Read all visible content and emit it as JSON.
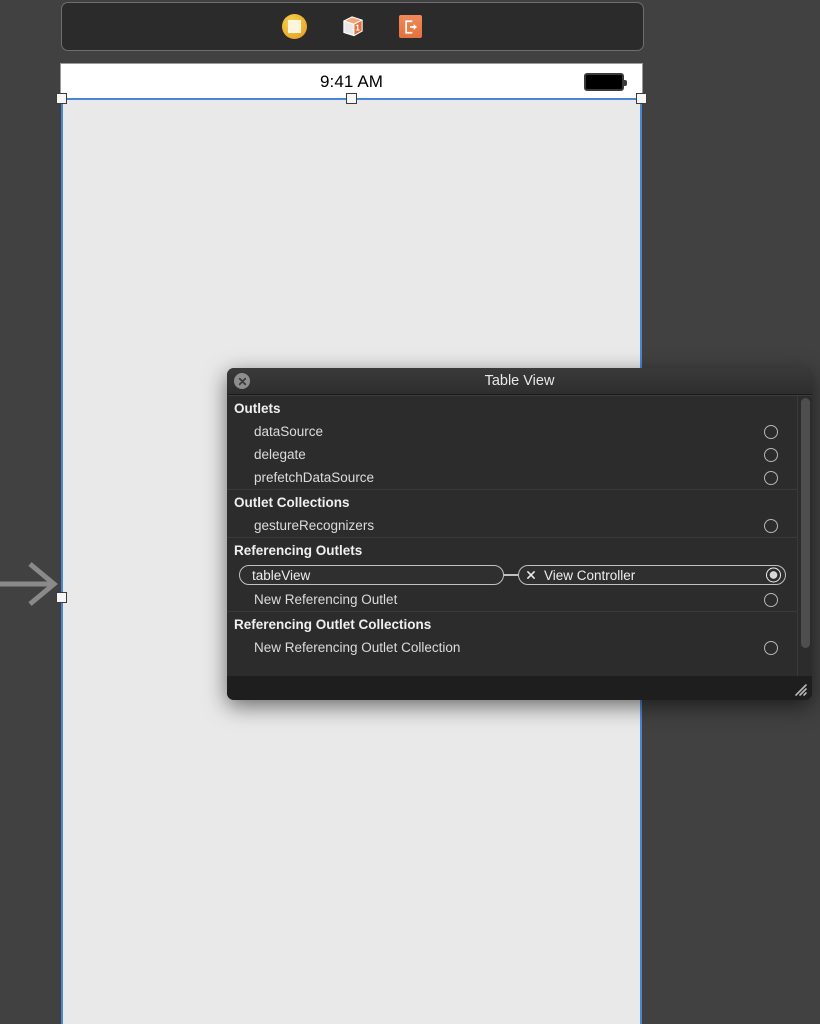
{
  "app": {
    "context": "xcode-interface-builder-storyboard-canvas"
  },
  "scene_dock": {
    "icons": [
      {
        "name": "view-controller-icon",
        "label": "View Controller",
        "color": "#eaa92b"
      },
      {
        "name": "first-responder-icon",
        "label": "First Responder",
        "color": "#e4713d"
      },
      {
        "name": "exit-icon",
        "label": "Exit",
        "color": "#e4713d"
      }
    ]
  },
  "device": {
    "status_bar": {
      "time": "9:41 AM",
      "battery": "battery-icon"
    },
    "view_background": "#e9e9e9",
    "selection_color": "#4a86d6"
  },
  "entry_point": {
    "name": "storyboard-entry-point-arrow"
  },
  "popover": {
    "title": "Table View",
    "close_label": "×",
    "sections": [
      {
        "header": "Outlets",
        "rows": [
          {
            "label": "dataSource",
            "connected": false
          },
          {
            "label": "delegate",
            "connected": false
          },
          {
            "label": "prefetchDataSource",
            "connected": false
          }
        ]
      },
      {
        "header": "Outlet Collections",
        "rows": [
          {
            "label": "gestureRecognizers",
            "connected": false
          }
        ]
      },
      {
        "header": "Referencing Outlets",
        "connection": {
          "outlet_name": "tableView",
          "target_name": "View Controller",
          "disconnect_label": "✖"
        },
        "rows": [
          {
            "label": "New Referencing Outlet",
            "connected": false
          }
        ]
      },
      {
        "header": "Referencing Outlet Collections",
        "rows": [
          {
            "label": "New Referencing Outlet Collection",
            "connected": false
          }
        ]
      }
    ]
  }
}
